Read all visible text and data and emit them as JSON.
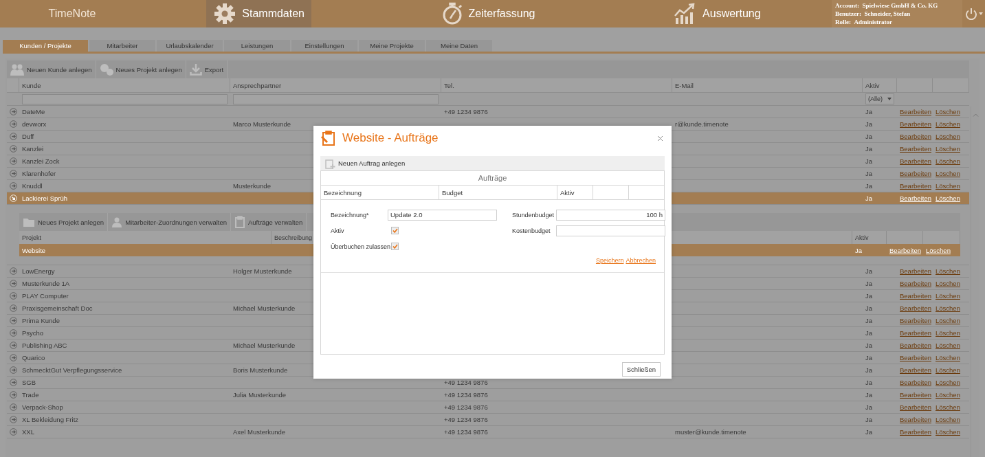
{
  "header": {
    "brand": "TimeNote",
    "nav": [
      {
        "label": "Stammdaten",
        "selected": true
      },
      {
        "label": "Zeiterfassung",
        "selected": false
      },
      {
        "label": "Auswertung",
        "selected": false
      }
    ],
    "account": [
      {
        "label": "Account:",
        "value": "Spielwiese GmbH & Co. KG"
      },
      {
        "label": "Benutzer:",
        "value": "Schneider, Stefan"
      },
      {
        "label": "Rolle:",
        "value": "Administrator"
      }
    ]
  },
  "tabs": [
    {
      "label": "Kunden / Projekte",
      "selected": true
    },
    {
      "label": "Mitarbeiter",
      "selected": false
    },
    {
      "label": "Urlaubskalender",
      "selected": false
    },
    {
      "label": "Leistungen",
      "selected": false
    },
    {
      "label": "Einstellungen",
      "selected": false
    },
    {
      "label": "Meine Projekte",
      "selected": false
    },
    {
      "label": "Meine Daten",
      "selected": false
    }
  ],
  "toolbar": [
    {
      "label": "Neuen Kunde anlegen"
    },
    {
      "label": "Neues Projekt anlegen"
    },
    {
      "label": "Export"
    }
  ],
  "table": {
    "columns": [
      "Kunde",
      "Ansprechpartner",
      "Tel.",
      "E-Mail",
      "Aktiv"
    ],
    "filters": [
      {
        "kind": "text"
      },
      {
        "kind": "text"
      },
      {
        "kind": "select",
        "value": "(Alle)"
      }
    ],
    "rows": [
      {
        "customer": "DateMe",
        "phone": "+49 1234 9876",
        "active": "Ja",
        "edit": "Bearbeiten",
        "delete": "Löschen",
        "selected": false,
        "expanded": false
      },
      {
        "customer": "devworx",
        "contact": "Marco Musterkunde",
        "email": "r@kunde.timenote",
        "active": "Ja",
        "edit": "Bearbeiten",
        "delete": "Löschen",
        "selected": false,
        "expanded": false
      },
      {
        "customer": "Duff",
        "active": "Ja",
        "edit": "Bearbeiten",
        "delete": "Löschen",
        "selected": false,
        "expanded": false
      },
      {
        "customer": "Kanzlei",
        "active": "Ja",
        "edit": "Bearbeiten",
        "delete": "Löschen",
        "selected": false,
        "expanded": false
      },
      {
        "customer": "Kanzlei Zock",
        "active": "Ja",
        "edit": "Bearbeiten",
        "delete": "Löschen",
        "selected": false,
        "expanded": false
      },
      {
        "customer": "Klarenhofer",
        "active": "Ja",
        "edit": "Bearbeiten",
        "delete": "Löschen",
        "selected": false,
        "expanded": false
      },
      {
        "customer": "Knuddl",
        "contact": "Musterkunde",
        "active": "Ja",
        "edit": "Bearbeiten",
        "delete": "Löschen",
        "selected": false,
        "expanded": false
      },
      {
        "customer": "Lackierei Sprüh",
        "active": "Ja",
        "edit": "Bearbeiten",
        "delete": "Löschen",
        "selected": true,
        "expanded": true,
        "detail": {
          "toolbar": [
            {
              "label": "Neues Projekt anlegen"
            },
            {
              "label": "Mitarbeiter-Zuordnungen verwalten"
            },
            {
              "label": "Aufträge verwalten"
            }
          ],
          "columns": [
            "Projekt",
            "Beschreibung",
            "Aktiv"
          ],
          "rows": [
            {
              "project": "Website",
              "active": "Ja",
              "edit": "Bearbeiten",
              "delete": "Löschen",
              "selected": true
            }
          ]
        }
      },
      {
        "customer": "LowEnergy",
        "contact": "Holger Musterkunde",
        "active": "Ja",
        "edit": "Bearbeiten",
        "delete": "Löschen",
        "selected": false,
        "expanded": false
      },
      {
        "customer": "Musterkunde 1A",
        "active": "Ja",
        "edit": "Bearbeiten",
        "delete": "Löschen",
        "selected": false,
        "expanded": false
      },
      {
        "customer": "PLAY Computer",
        "active": "Ja",
        "edit": "Bearbeiten",
        "delete": "Löschen",
        "selected": false,
        "expanded": false
      },
      {
        "customer": "Praxisgemeinschaft Doc",
        "contact": "Michael Musterkunde",
        "active": "Ja",
        "edit": "Bearbeiten",
        "delete": "Löschen",
        "selected": false,
        "expanded": false
      },
      {
        "customer": "Prima Kunde",
        "active": "Ja",
        "edit": "Bearbeiten",
        "delete": "Löschen",
        "selected": false,
        "expanded": false
      },
      {
        "customer": "Psycho",
        "active": "Ja",
        "edit": "Bearbeiten",
        "delete": "Löschen",
        "selected": false,
        "expanded": false
      },
      {
        "customer": "Publishing ABC",
        "contact": "Michael Musterkunde",
        "active": "Ja",
        "edit": "Bearbeiten",
        "delete": "Löschen",
        "selected": false,
        "expanded": false
      },
      {
        "customer": "Quarico",
        "active": "Ja",
        "edit": "Bearbeiten",
        "delete": "Löschen",
        "selected": false,
        "expanded": false
      },
      {
        "customer": "SchmecktGut Verpflegungsservice",
        "contact": "Boris Musterkunde",
        "active": "Ja",
        "edit": "Bearbeiten",
        "delete": "Löschen",
        "selected": false,
        "expanded": false
      },
      {
        "customer": "SGB",
        "phone": "+49 1234 9876",
        "active": "Ja",
        "edit": "Bearbeiten",
        "delete": "Löschen",
        "selected": false,
        "expanded": false
      },
      {
        "customer": "Trade",
        "contact": "Julia Musterkunde",
        "phone": "+49 1234 9876",
        "active": "Ja",
        "edit": "Bearbeiten",
        "delete": "Löschen",
        "selected": false,
        "expanded": false
      },
      {
        "customer": "Verpack-Shop",
        "phone": "+49 1234 9876",
        "active": "Ja",
        "edit": "Bearbeiten",
        "delete": "Löschen",
        "selected": false,
        "expanded": false
      },
      {
        "customer": "XL Bekleidung Fritz",
        "phone": "+49 1234 9876",
        "active": "Ja",
        "edit": "Bearbeiten",
        "delete": "Löschen",
        "selected": false,
        "expanded": false
      },
      {
        "customer": "XXL",
        "contact": "Axel Musterkunde",
        "phone": "+49 1234 9876",
        "email": "muster@kunde.timenote",
        "active": "Ja",
        "edit": "Bearbeiten",
        "delete": "Löschen",
        "selected": false,
        "expanded": false
      }
    ]
  },
  "dialog": {
    "title": "Website - Aufträge",
    "toolbar": {
      "label": "Neuen Auftrag anlegen"
    },
    "grid": {
      "caption": "Aufträge",
      "columns": [
        "Bezeichnung",
        "Budget",
        "Aktiv"
      ]
    },
    "form": {
      "left": [
        {
          "kind": "text",
          "label": "Bezeichnung*",
          "value": "Update 2.0"
        },
        {
          "kind": "checkbox",
          "label": "Aktiv",
          "checked": true
        },
        {
          "kind": "checkbox",
          "label": "Überbuchen zulassen",
          "checked": true
        }
      ],
      "right": [
        {
          "kind": "text",
          "label": "Stundenbudget",
          "value": "100 h"
        },
        {
          "kind": "text",
          "label": "Kostenbudget"
        }
      ]
    },
    "actions": [
      "Speichern",
      "Abbrechen"
    ],
    "close_button": "Schließen"
  }
}
